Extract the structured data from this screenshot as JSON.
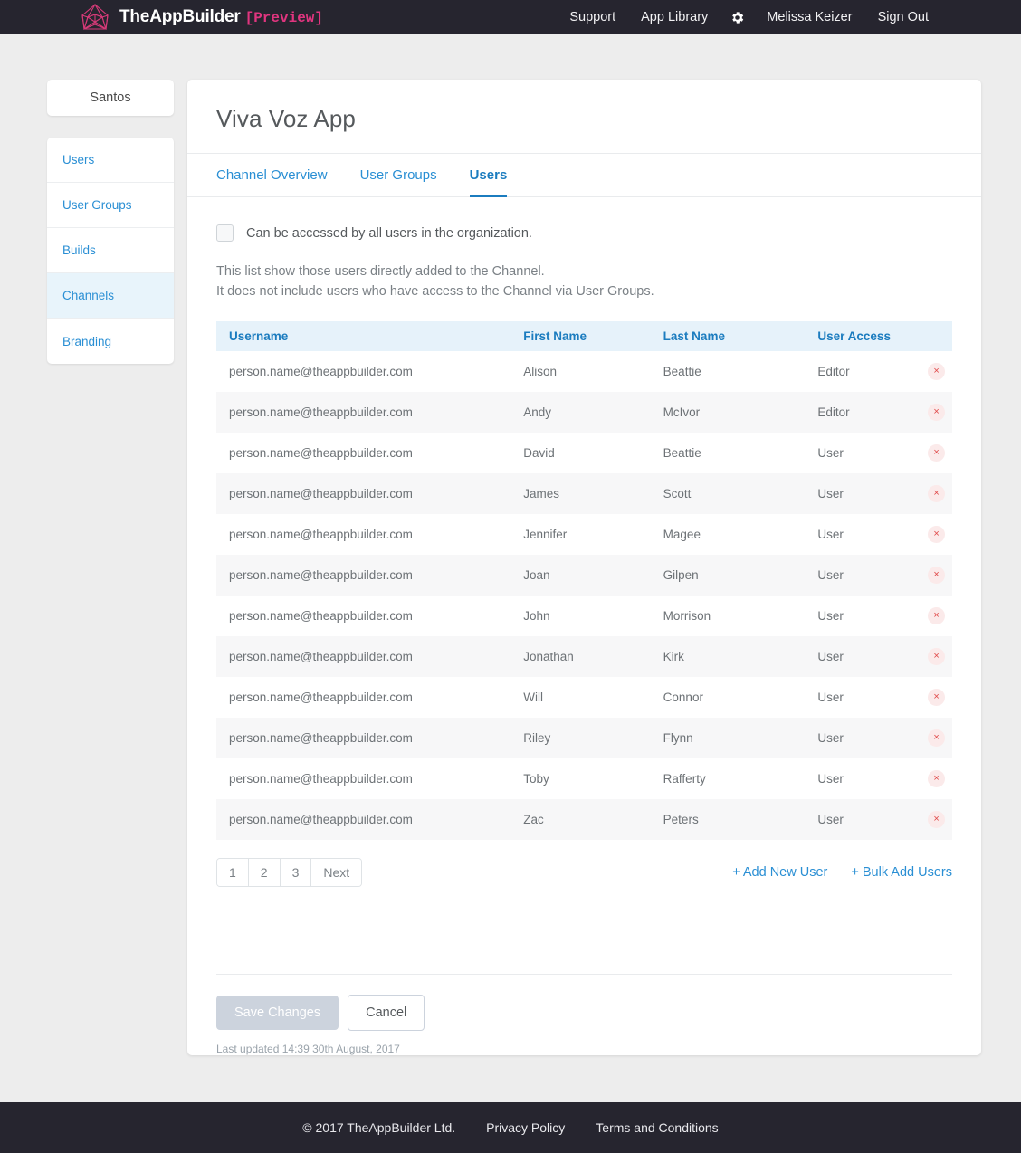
{
  "topbar": {
    "brand_the": "The",
    "brand_app": "App",
    "brand_builder": "Builder",
    "preview_tag": "[Preview]",
    "logo_icon": "polygon-wireframe-logo",
    "nav": [
      {
        "label": "Support"
      },
      {
        "label": "App Library"
      }
    ],
    "gear_icon": "gear-icon",
    "user_name": "Melissa Keizer",
    "sign_out": "Sign Out"
  },
  "sidebar": {
    "org": "Santos",
    "items": [
      {
        "label": "Users",
        "active": false
      },
      {
        "label": "User Groups",
        "active": false
      },
      {
        "label": "Builds",
        "active": false
      },
      {
        "label": "Channels",
        "active": true
      },
      {
        "label": "Branding",
        "active": false
      }
    ]
  },
  "main": {
    "title": "Viva Voz App",
    "tabs": [
      {
        "label": "Channel Overview",
        "active": false
      },
      {
        "label": "User Groups",
        "active": false
      },
      {
        "label": "Users",
        "active": true
      }
    ],
    "access_checkbox": {
      "label": "Can be accessed by all users in the organization.",
      "checked": false
    },
    "description_line1": "This list show those users directly added to the Channel.",
    "description_line2": "It does not include users who have access to the Channel via User Groups.",
    "table": {
      "columns": [
        "Username",
        "First Name",
        "Last Name",
        "User Access"
      ],
      "delete_icon": "×",
      "rows": [
        {
          "username": "person.name@theappbuilder.com",
          "first": "Alison",
          "last": "Beattie",
          "access": "Editor"
        },
        {
          "username": "person.name@theappbuilder.com",
          "first": "Andy",
          "last": "McIvor",
          "access": "Editor"
        },
        {
          "username": "person.name@theappbuilder.com",
          "first": "David",
          "last": "Beattie",
          "access": "User"
        },
        {
          "username": "person.name@theappbuilder.com",
          "first": "James",
          "last": "Scott",
          "access": "User"
        },
        {
          "username": "person.name@theappbuilder.com",
          "first": "Jennifer",
          "last": "Magee",
          "access": "User"
        },
        {
          "username": "person.name@theappbuilder.com",
          "first": "Joan",
          "last": "Gilpen",
          "access": "User"
        },
        {
          "username": "person.name@theappbuilder.com",
          "first": "John",
          "last": "Morrison",
          "access": "User"
        },
        {
          "username": "person.name@theappbuilder.com",
          "first": "Jonathan",
          "last": "Kirk",
          "access": "User"
        },
        {
          "username": "person.name@theappbuilder.com",
          "first": "Will",
          "last": "Connor",
          "access": "User"
        },
        {
          "username": "person.name@theappbuilder.com",
          "first": "Riley",
          "last": "Flynn",
          "access": "User"
        },
        {
          "username": "person.name@theappbuilder.com",
          "first": "Toby",
          "last": "Rafferty",
          "access": "User"
        },
        {
          "username": "person.name@theappbuilder.com",
          "first": "Zac",
          "last": "Peters",
          "access": "User"
        }
      ]
    },
    "pagination": [
      "1",
      "2",
      "3",
      "Next"
    ],
    "actions": [
      {
        "label": "+ Add New User"
      },
      {
        "label": "+ Bulk Add Users"
      }
    ],
    "save_label": "Save Changes",
    "cancel_label": "Cancel",
    "last_updated": "Last updated 14:39 30th August, 2017"
  },
  "footer": {
    "copyright": "© 2017 TheAppBuilder Ltd.",
    "links": [
      {
        "label": "Privacy Policy"
      },
      {
        "label": "Terms and Conditions"
      }
    ]
  },
  "colors": {
    "brand_pink": "#e0357f",
    "accent_blue": "#2a8fd4",
    "dark_bar": "#26252f",
    "page_bg": "#ededed",
    "danger_red": "#e04a4a"
  }
}
